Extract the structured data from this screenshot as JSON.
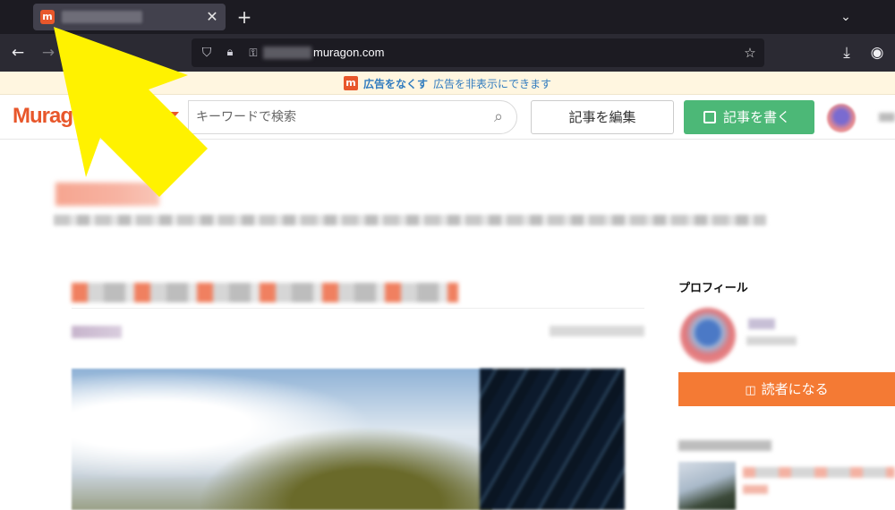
{
  "browser": {
    "tab": {
      "favicon_letter": "m"
    },
    "new_tab_label": "+",
    "url": {
      "host_suffix": "muragon.com"
    }
  },
  "adbar": {
    "logo_letter": "m",
    "link_text": "広告をなくす",
    "text": "広告を非表示にできます"
  },
  "header": {
    "logo_text": "Muragon",
    "search_placeholder": "キーワードで検索",
    "edit_button": "記事を編集",
    "write_button": "記事を書く"
  },
  "sidebar": {
    "profile_heading": "プロフィール",
    "subscribe_button": "読者になる"
  },
  "colors": {
    "brand_orange": "#e8572b",
    "write_green": "#4cb877",
    "subscribe_orange": "#f47a34",
    "arrow_yellow": "#fff200"
  },
  "icons": {
    "back": "arrow-left-icon",
    "forward": "arrow-right-icon",
    "shield": "shield-icon",
    "lock": "lock-icon",
    "star": "star-icon",
    "download": "download-icon",
    "account": "account-icon",
    "search": "search-icon",
    "write": "pencil-square-icon",
    "subscribe": "book-icon"
  }
}
